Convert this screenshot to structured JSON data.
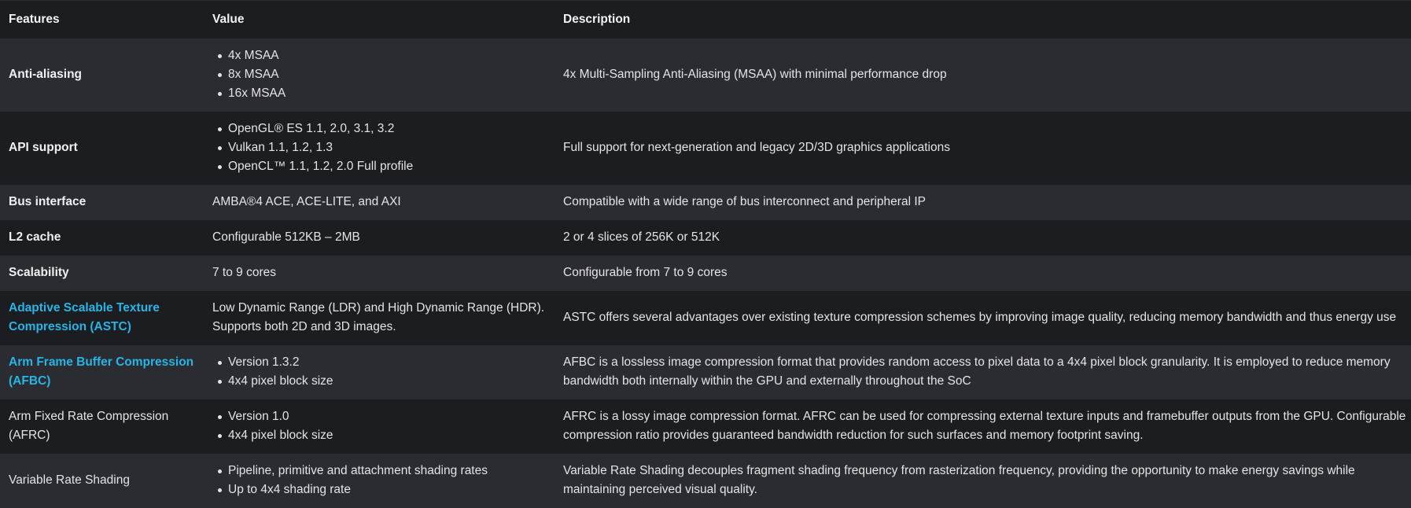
{
  "headers": {
    "features": "Features",
    "value": "Value",
    "description": "Description"
  },
  "rows": [
    {
      "feature": "Anti-aliasing",
      "values": [
        "4x MSAA",
        "8x MSAA",
        "16x MSAA"
      ],
      "description": "4x Multi-Sampling Anti-Aliasing (MSAA) with minimal performance drop"
    },
    {
      "feature": "API support",
      "values": [
        "OpenGL® ES 1.1, 2.0, 3.1, 3.2",
        "Vulkan 1.1, 1.2, 1.3",
        "OpenCL™ 1.1, 1.2, 2.0 Full profile"
      ],
      "description": "Full support for next-generation and legacy 2D/3D graphics applications"
    },
    {
      "feature": "Bus interface",
      "value": "AMBA®4 ACE, ACE-LITE, and AXI",
      "description": "Compatible with a wide range of bus interconnect and peripheral IP"
    },
    {
      "feature": "L2 cache",
      "value": "Configurable 512KB – 2MB",
      "description": "2 or 4 slices of 256K or 512K"
    },
    {
      "feature": "Scalability",
      "value": "7 to 9 cores",
      "description": "Configurable from 7 to 9 cores"
    },
    {
      "feature": "Adaptive Scalable Texture Compression (ASTC)",
      "value": "Low Dynamic Range (LDR) and High Dynamic Range (HDR). Supports both 2D and 3D images.",
      "description": "ASTC offers several advantages over existing texture compression schemes by improving image quality, reducing memory bandwidth and thus energy use"
    },
    {
      "feature": "Arm Frame Buffer Compression (AFBC)",
      "values": [
        "Version 1.3.2",
        "4x4 pixel block size"
      ],
      "description": "AFBC is a lossless image compression format that provides random access to pixel data to a 4x4 pixel block granularity. It is employed to reduce memory bandwidth both internally within the GPU and externally throughout the SoC"
    },
    {
      "feature": "Arm Fixed Rate Compression (AFRC)",
      "values": [
        "Version 1.0",
        "4x4 pixel block size"
      ],
      "description": "AFRC is a lossy image compression format. AFRC can be used for compressing external texture inputs and framebuffer outputs from the GPU. Configurable compression ratio provides guaranteed bandwidth reduction for such surfaces and memory footprint saving."
    },
    {
      "feature": "Variable Rate Shading",
      "values": [
        "Pipeline, primitive and attachment shading rates",
        "Up to 4x4 shading rate"
      ],
      "description": "Variable Rate Shading decouples fragment shading frequency from rasterization frequency, providing the opportunity to make energy savings while maintaining perceived visual quality."
    }
  ],
  "colors": {
    "link": "#27b5e5",
    "row_dark": "#1c1d21",
    "row_light": "#2b2c31"
  }
}
